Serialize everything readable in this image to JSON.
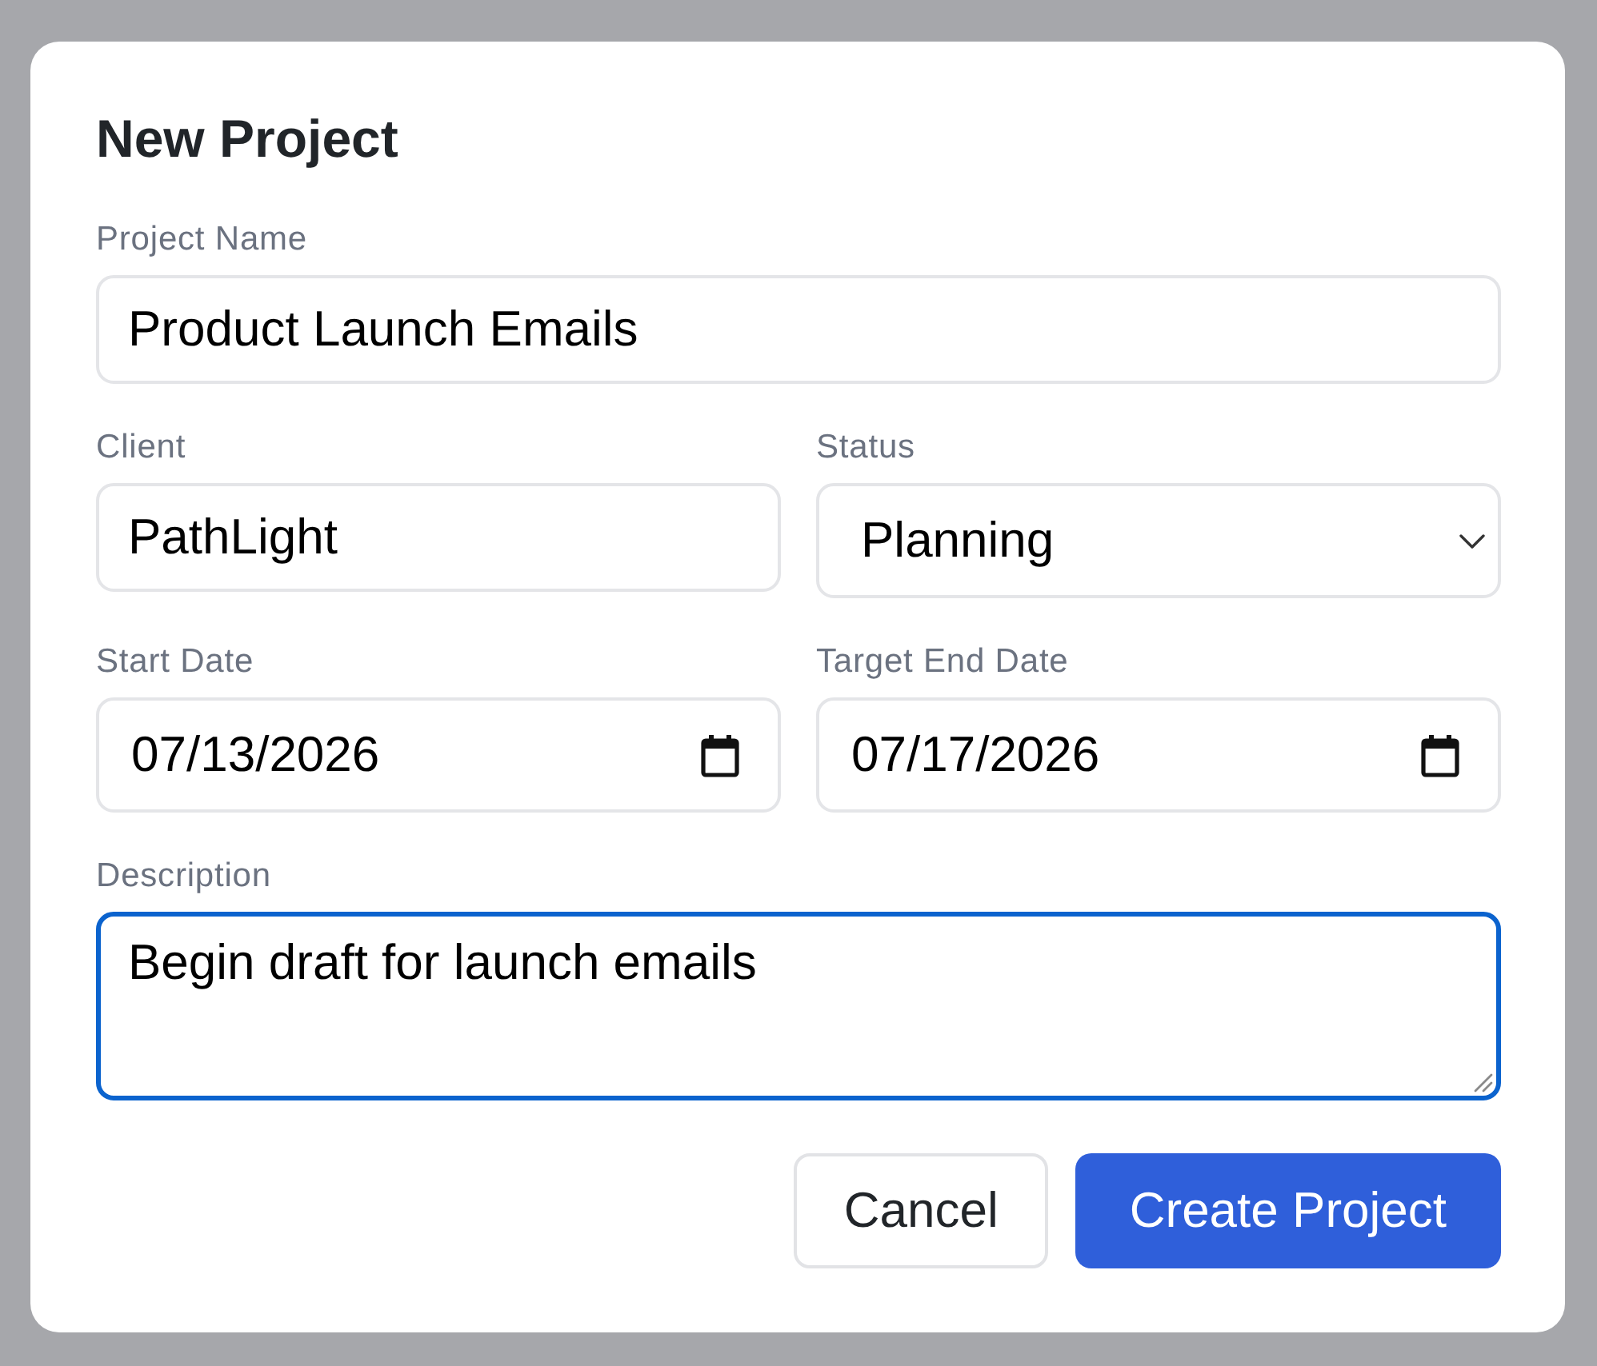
{
  "dialog": {
    "title": "New Project",
    "rows": [
      {
        "fields": [
          {
            "kind": "text",
            "label": "Project Name",
            "value": "Product Launch Emails",
            "focused": false
          }
        ]
      },
      {
        "fields": [
          {
            "kind": "text",
            "label": "Client",
            "value": "PathLight",
            "focused": false
          },
          {
            "kind": "select",
            "label": "Status",
            "value": "Planning",
            "focused": false
          }
        ]
      },
      {
        "fields": [
          {
            "kind": "date",
            "label": "Start Date",
            "value": "07/13/2026",
            "focused": false
          },
          {
            "kind": "date",
            "label": "Target End Date",
            "value": "07/17/2026",
            "focused": false
          }
        ]
      },
      {
        "fields": [
          {
            "kind": "textarea",
            "label": "Description",
            "value": "Begin draft for launch emails",
            "focused": true
          }
        ]
      }
    ],
    "buttons": [
      {
        "kind": "secondary",
        "label": "Cancel"
      },
      {
        "kind": "primary",
        "label": "Create Project"
      }
    ]
  }
}
